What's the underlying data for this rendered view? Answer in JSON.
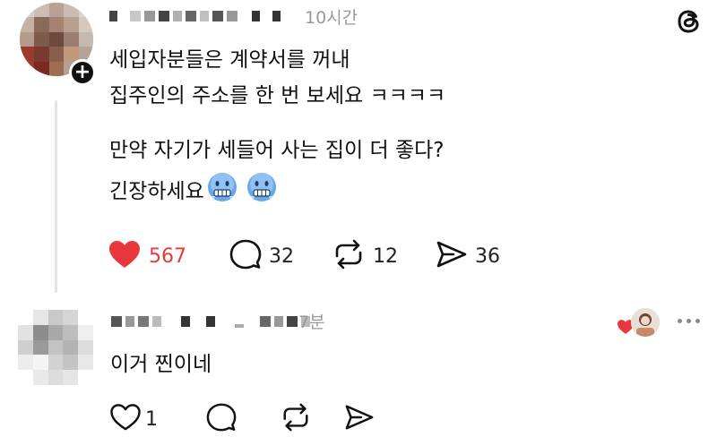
{
  "post": {
    "time": "10시간",
    "body_lines": [
      "세입자분들은 계약서를 꺼내",
      "집주인의 주소를 한 번 보세요 ㅋㅋㅋㅋ",
      "만약 자기가 세들어 사는 집이 더 좋다?",
      "긴장하세요"
    ],
    "emoji": [
      "cold-face",
      "cold-face"
    ],
    "likes": "567",
    "comments": "32",
    "reposts": "12",
    "shares": "36",
    "colors": {
      "like": "#e8383d"
    }
  },
  "reply": {
    "time": "7분",
    "body": "이거 찐이네",
    "likes": "1"
  },
  "app": {
    "logo": "threads-icon"
  }
}
